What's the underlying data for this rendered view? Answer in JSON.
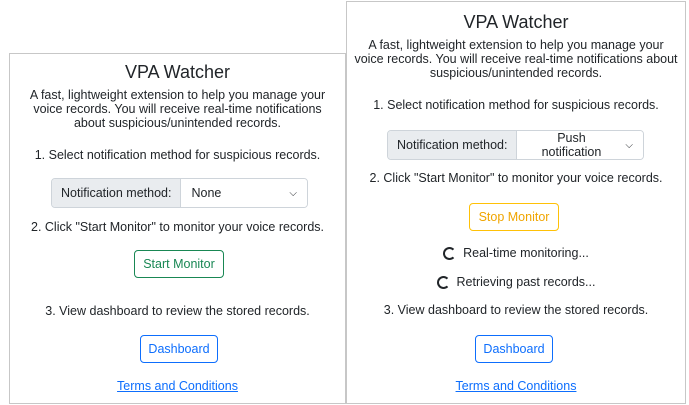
{
  "left": {
    "title": "VPA Watcher",
    "description": "A fast, lightweight extension to help you manage your voice records. You will receive real-time notifications about suspicious/unintended records.",
    "step1": "1. Select notification method for suspicious records.",
    "select_label": "Notification method:",
    "select_value": "None",
    "step2": "2. Click \"Start Monitor\" to monitor your voice records.",
    "monitor_button": "Start Monitor",
    "step3": "3. View dashboard to review the stored records.",
    "dashboard_button": "Dashboard",
    "terms_link": "Terms and Conditions"
  },
  "right": {
    "title": "VPA Watcher",
    "description": "A fast, lightweight extension to help you manage your voice records. You will receive real-time notifications about suspicious/unintended records.",
    "step1": "1. Select notification method for suspicious records.",
    "select_label": "Notification method:",
    "select_value": "Push notification",
    "step2": "2. Click \"Start Monitor\" to monitor your voice records.",
    "monitor_button": "Stop Monitor",
    "status_realtime": "Real-time monitoring...",
    "status_past": "Retrieving past records...",
    "step3": "3. View dashboard to review the stored records.",
    "dashboard_button": "Dashboard",
    "terms_link": "Terms and Conditions"
  },
  "colors": {
    "success": "#198754",
    "warning": "#ffc107",
    "primary": "#0d6efd"
  },
  "icons": {
    "select_caret": "chevron-down-icon",
    "status": "spinner-icon"
  }
}
